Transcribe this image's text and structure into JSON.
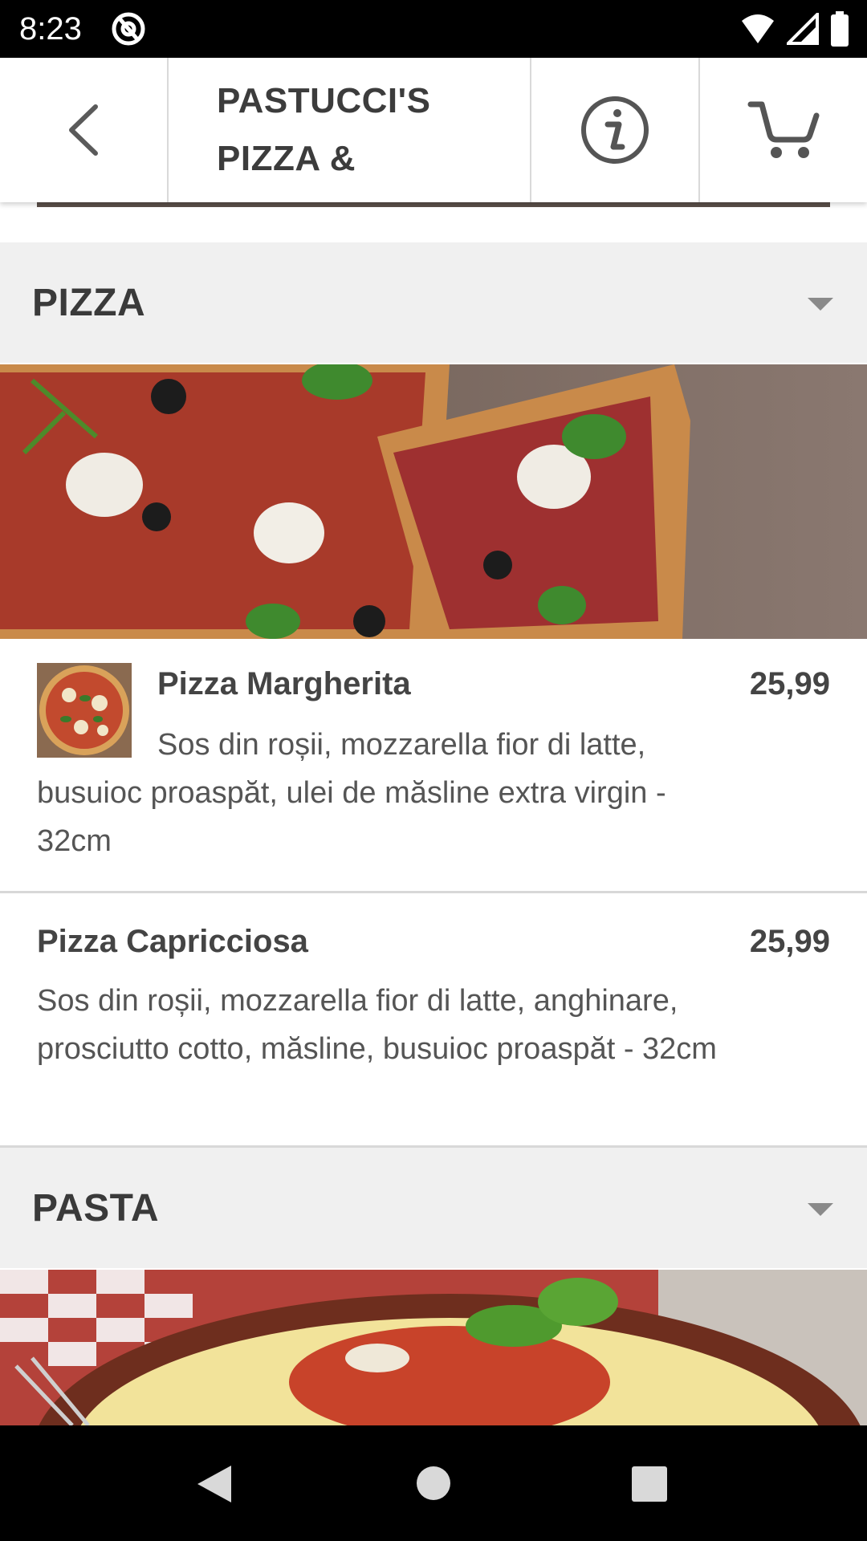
{
  "status_bar": {
    "time": "8:23"
  },
  "header": {
    "title": "PASTUCCI'S PIZZA &",
    "back_icon": "chevron-left-icon",
    "info_icon": "info-icon",
    "cart_icon": "cart-icon"
  },
  "sections": [
    {
      "title": "PIZZA",
      "items": [
        {
          "name": "Pizza Margherita",
          "price": "25,99",
          "description": "Sos din roșii, mozzarella fior di latte, busuioc proaspăt, ulei de măsline extra virgin - 32cm"
        },
        {
          "name": "Pizza Capricciosa",
          "price": "25,99",
          "description": "Sos din roșii, mozzarella fior di latte, anghinare, prosciutto cotto, măsline, busuioc proaspăt - 32cm"
        }
      ]
    },
    {
      "title": "PASTA",
      "items": []
    }
  ],
  "colors": {
    "section_bg": "#f0f0f0",
    "text": "#3e3e3e",
    "divider": "#d8d8d8"
  }
}
